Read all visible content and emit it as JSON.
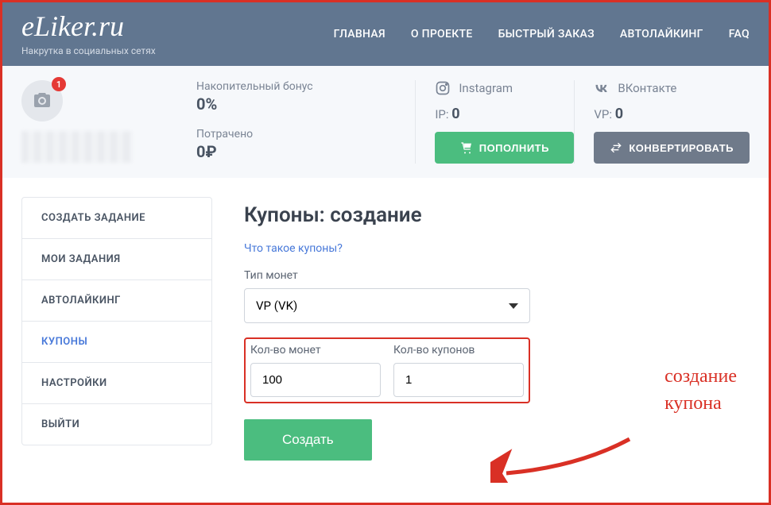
{
  "header": {
    "logo": "eLiker.ru",
    "tagline": "Накрутка в социальных сетях",
    "nav": [
      "ГЛАВНАЯ",
      "О ПРОЕКТЕ",
      "БЫСТРЫЙ ЗАКАЗ",
      "АВТОЛАЙКИНГ",
      "FAQ"
    ]
  },
  "stats": {
    "avatar_badge": "1",
    "bonus_label": "Накопительный бонус",
    "bonus_value": "0%",
    "spent_label": "Потрачено",
    "spent_value": "0₽",
    "instagram_label": "Instagram",
    "instagram_points_label": "IP:",
    "instagram_points": "0",
    "topup_button": "ПОПОЛНИТЬ",
    "vk_label": "ВКонтакте",
    "vk_points_label": "VP:",
    "vk_points": "0",
    "convert_button": "КОНВЕРТИРОВАТЬ"
  },
  "sidebar": {
    "items": [
      "СОЗДАТЬ ЗАДАНИЕ",
      "МОИ ЗАДАНИЯ",
      "АВТОЛАЙКИНГ",
      "КУПОНЫ",
      "НАСТРОЙКИ",
      "ВЫЙТИ"
    ],
    "active_index": 3
  },
  "content": {
    "title": "Купоны: создание",
    "help_link": "Что такое купоны?",
    "coin_type_label": "Тип монет",
    "coin_type_value": "VP (VK)",
    "coins_label": "Кол-во монет",
    "coins_value": "100",
    "coupons_label": "Кол-во купонов",
    "coupons_value": "1",
    "create_button": "Создать"
  },
  "annotation": {
    "line1": "создание",
    "line2": "купона"
  }
}
